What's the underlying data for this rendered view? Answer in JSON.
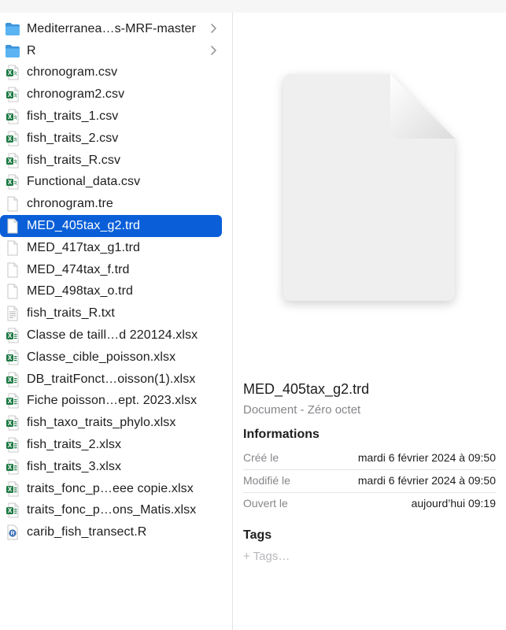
{
  "colors": {
    "selection": "#0a5fd8",
    "folder": "#56aef0",
    "excel_green": "#1e7a44",
    "secondary_text": "#86868b"
  },
  "files": [
    {
      "name": "Mediterranea…s-MRF-master",
      "icon": "folder-icon",
      "has_chevron": true
    },
    {
      "name": "R",
      "icon": "folder-icon",
      "has_chevron": true
    },
    {
      "name": "chronogram.csv",
      "icon": "csv-file-icon"
    },
    {
      "name": "chronogram2.csv",
      "icon": "csv-file-icon"
    },
    {
      "name": "fish_traits_1.csv",
      "icon": "csv-file-icon"
    },
    {
      "name": "fish_traits_2.csv",
      "icon": "csv-file-icon"
    },
    {
      "name": "fish_traits_R.csv",
      "icon": "csv-file-icon"
    },
    {
      "name": "Functional_data.csv",
      "icon": "csv-file-icon"
    },
    {
      "name": "chronogram.tre",
      "icon": "blank-file-icon"
    },
    {
      "name": "MED_405tax_g2.trd",
      "icon": "blank-file-icon",
      "selected": true
    },
    {
      "name": "MED_417tax_g1.trd",
      "icon": "blank-file-icon"
    },
    {
      "name": "MED_474tax_f.trd",
      "icon": "blank-file-icon"
    },
    {
      "name": "MED_498tax_o.trd",
      "icon": "blank-file-icon"
    },
    {
      "name": "fish_traits_R.txt",
      "icon": "text-file-icon"
    },
    {
      "name": "Classe de taill…d 220124.xlsx",
      "icon": "xlsx-file-icon"
    },
    {
      "name": "Classe_cible_poisson.xlsx",
      "icon": "xlsx-file-icon"
    },
    {
      "name": "DB_traitFonct…oisson(1).xlsx",
      "icon": "xlsx-file-icon"
    },
    {
      "name": "Fiche poisson…ept. 2023.xlsx",
      "icon": "xlsx-file-icon"
    },
    {
      "name": "fish_taxo_traits_phylo.xlsx",
      "icon": "xlsx-file-icon"
    },
    {
      "name": "fish_traits_2.xlsx",
      "icon": "xlsx-file-icon"
    },
    {
      "name": "fish_traits_3.xlsx",
      "icon": "xlsx-file-icon"
    },
    {
      "name": "traits_fonc_p…eee copie.xlsx",
      "icon": "xlsx-file-icon"
    },
    {
      "name": "traits_fonc_p…ons_Matis.xlsx",
      "icon": "xlsx-file-icon"
    },
    {
      "name": "carib_fish_transect.R",
      "icon": "r-file-icon"
    }
  ],
  "preview": {
    "filename": "MED_405tax_g2.trd",
    "subtitle": "Document - Zéro octet",
    "info_title": "Informations",
    "info": [
      {
        "key": "Créé le",
        "value": "mardi 6 février 2024 à 09:50"
      },
      {
        "key": "Modifié le",
        "value": "mardi 6 février 2024 à 09:50"
      },
      {
        "key": "Ouvert le",
        "value": "aujourd’hui 09:19"
      }
    ],
    "tags_title": "Tags",
    "tags_placeholder": "+ Tags…"
  }
}
